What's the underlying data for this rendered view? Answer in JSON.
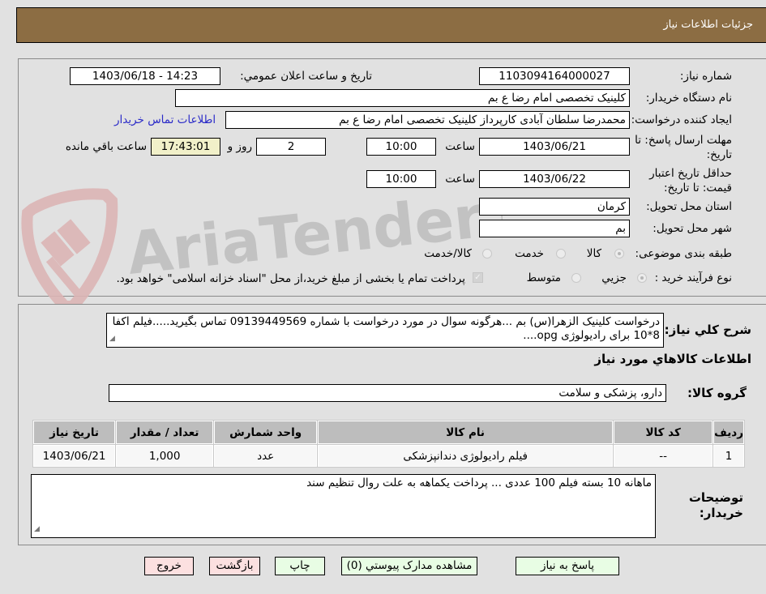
{
  "header": {
    "title": "جزئیات اطلاعات نیاز"
  },
  "form": {
    "need_number_label": "شماره نیاز:",
    "need_number": "1103094164000027",
    "announce_label": "تاریخ و ساعت اعلان عمومي:",
    "announce_value": "1403/06/18 - 14:23",
    "buyer_org_label": "نام دستگاه خریدار:",
    "buyer_org": "کلینیک تخصصی امام رضا  ع  بم",
    "requester_label": "ایجاد کننده درخواست:",
    "requester": "محمدرضا سلطان آبادی کارپرداز کلینیک تخصصی امام رضا  ع  بم",
    "buyer_contact_link": "اطلاعات تماس خریدار",
    "deadline_label_1": "مهلت ارسال پاسخ: تا",
    "deadline_label_2": "تاریخ:",
    "deadline_date": "1403/06/21",
    "time_label": "ساعت",
    "deadline_time": "10:00",
    "days_remaining": "2",
    "days_label": "روز و",
    "time_remaining": "17:43:01",
    "time_remaining_label": "ساعت باقي مانده",
    "validity_label_1": "حداقل تاریخ اعتبار",
    "validity_label_2": "قیمت: تا تاریخ:",
    "validity_date": "1403/06/22",
    "validity_time": "10:00",
    "province_label": "استان محل تحویل:",
    "province": "کرمان",
    "city_label": "شهر محل تحویل:",
    "city": "بم",
    "category_label": "طبقه بندی موضوعی:",
    "category_options": [
      {
        "label": "کالا",
        "checked": true
      },
      {
        "label": "خدمت",
        "checked": false
      },
      {
        "label": "کالا/خدمت",
        "checked": false
      }
    ],
    "process_label": "نوع فرآیند خرید :",
    "process_options": [
      {
        "label": "جزيي",
        "checked": true
      },
      {
        "label": "متوسط",
        "checked": false
      }
    ],
    "payment_checkbox_checked": true,
    "payment_note": "پرداخت تمام یا بخشی از مبلغ خرید،از محل \"اسناد خزانه اسلامی\" خواهد بود."
  },
  "details": {
    "description_label": "شرح کلي نياز:",
    "description": "درخواست کلینیک  الزهرا(س) بم ...هرگونه سوال در مورد درخواست با شماره 09139449569 تماس بگیرید.....فیلم اکفا 8*10 برای رادیولوژی opg....",
    "items_section_title": "اطلاعات کالاهاي مورد نياز",
    "goods_group_label": "گروه کالا:",
    "goods_group": "دارو، پزشکی و سلامت",
    "table": {
      "headers": [
        "رديف",
        "کد کالا",
        "نام کالا",
        "واحد شمارش",
        "تعداد / مقدار",
        "تاريخ نياز"
      ],
      "rows": [
        [
          "1",
          "--",
          "فیلم رادیولوژی دندانپزشکی",
          "عدد",
          "1,000",
          "1403/06/21"
        ]
      ]
    },
    "buyer_notes_label_1": "توضیحات",
    "buyer_notes_label_2": "خریدار:",
    "buyer_notes": "ماهانه 10 بسته فیلم 100 عددی ... پرداخت یکماهه به علت روال تنظیم سند"
  },
  "buttons": {
    "reply": "پاسخ به نياز",
    "attachments": "مشاهده مدارک پيوستي (0)",
    "print": "چاپ",
    "back": "بازگشت",
    "exit": "خروج"
  },
  "watermark": {
    "text": "AriaTender.neT"
  }
}
